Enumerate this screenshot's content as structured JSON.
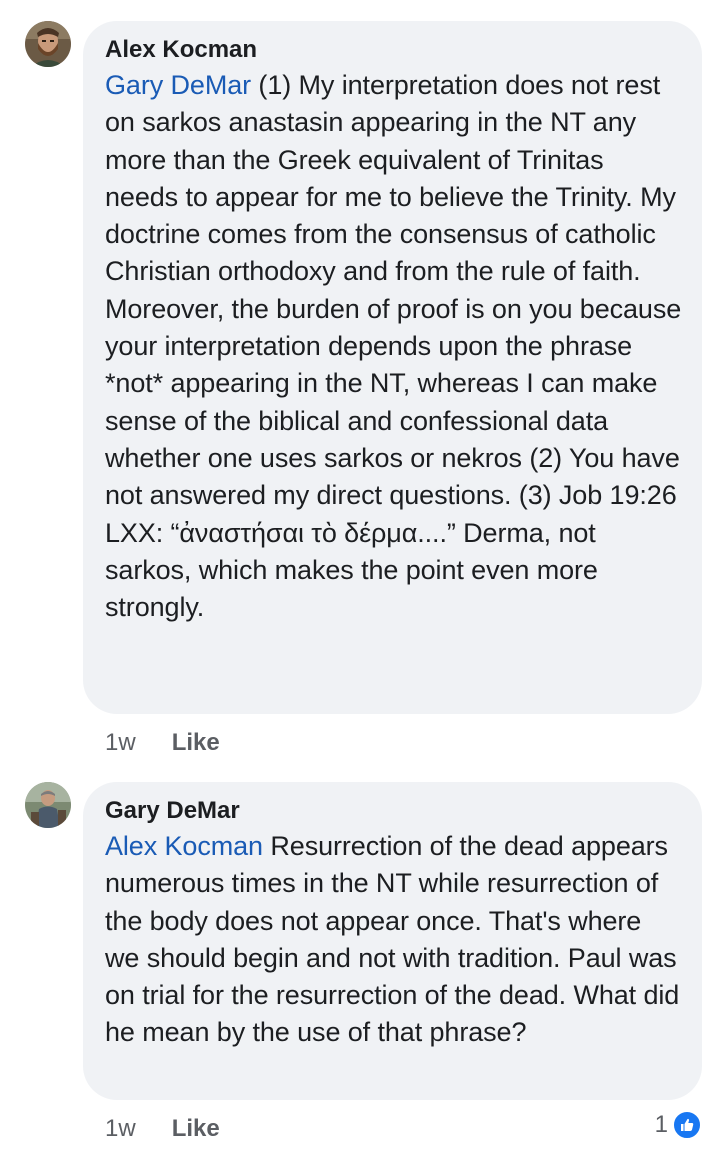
{
  "comments": [
    {
      "author": "Alex Kocman",
      "mention": "Gary DeMar",
      "text": " (1) My interpretation does not rest on sarkos anastasin appearing in the NT any more than the Greek equivalent of Trinitas needs to appear for me to believe the Trinity. My doctrine comes from the consensus of catholic Christian orthodoxy and from the rule of faith. Moreover, the burden of proof is on you because your interpretation depends upon the phrase *not* appearing in the NT, whereas I can make sense of the biblical and confessional data whether one uses sarkos or nekros (2) You have not answered my direct questions. (3) Job 19:26 LXX: “ἀναστήσαι τὸ δέρμα....” Derma, not sarkos, which makes the point even more strongly.",
      "time": "1w",
      "like_label": "Like",
      "avatar_icon": "user-avatar-bearded-man"
    },
    {
      "author": "Gary DeMar",
      "mention": "Alex Kocman",
      "text": " Resurrection of the dead appears numerous times in the NT while resurrection of the body does not appear once. That's where we should begin and not with tradition. Paul was on trial for the resurrection of the dead. What did he mean by the use of that phrase?",
      "time": "1w",
      "like_label": "Like",
      "reaction_count": "1",
      "reaction_icon": "thumbs-up-icon",
      "avatar_icon": "user-avatar-man-outdoors"
    }
  ],
  "colors": {
    "bubble": "#f0f2f5",
    "mention": "#1a5bb5",
    "like_badge": "#1877f2",
    "meta_text": "#5b5e63"
  }
}
